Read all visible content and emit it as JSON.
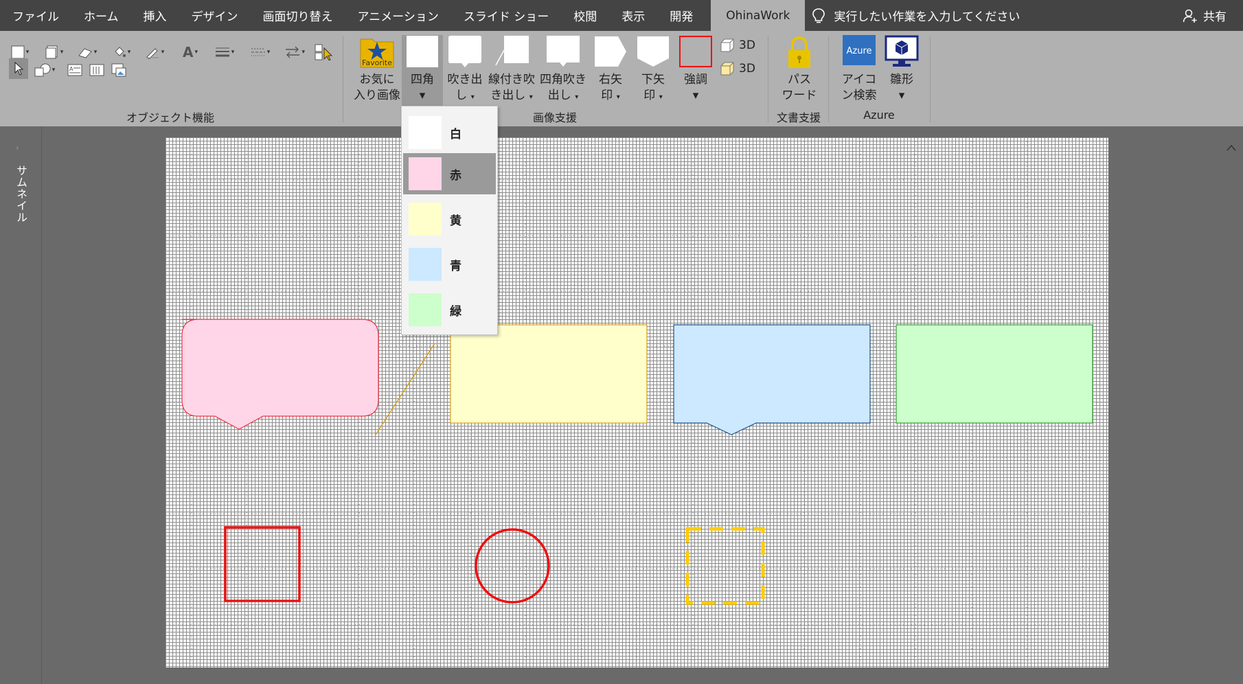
{
  "menu": {
    "tabs": [
      "ファイル",
      "ホーム",
      "挿入",
      "デザイン",
      "画面切り替え",
      "アニメーション",
      "スライド ショー",
      "校閲",
      "表示",
      "開発"
    ],
    "active_tab": "OhinaWork",
    "tell_me": "実行したい作業を入力してください",
    "share": "共有"
  },
  "ribbon": {
    "groups": {
      "object": "オブジェクト機能",
      "image": "画像支援",
      "document": "文書支援",
      "azure": "Azure"
    },
    "favorite_icon_text": "Favorite",
    "buttons": {
      "favorite": [
        "お気に",
        "入り画像"
      ],
      "square": [
        "四角",
        ""
      ],
      "callout": [
        "吹き出",
        "し"
      ],
      "line_callout": [
        "線付き吹",
        "き出し"
      ],
      "square_callout": [
        "四角吹き",
        "出し"
      ],
      "right_arrow": [
        "右矢",
        "印"
      ],
      "down_arrow": [
        "下矢",
        "印"
      ],
      "emphasis": [
        "強調",
        ""
      ],
      "password": [
        "パス",
        "ワード"
      ],
      "icon_search": [
        "アイコ",
        "ン検索"
      ],
      "template": [
        "雛形",
        ""
      ]
    },
    "azure_icon_text": "Azure",
    "three_d_1": "3D",
    "three_d_2": "3D"
  },
  "dropdown": {
    "items": [
      {
        "label": "白",
        "color": "#ffffff"
      },
      {
        "label": "赤",
        "color": "#ffd5e8"
      },
      {
        "label": "黄",
        "color": "#ffffcc"
      },
      {
        "label": "青",
        "color": "#cce9ff"
      },
      {
        "label": "緑",
        "color": "#ccffcc"
      }
    ],
    "hover_index": 1
  },
  "thumbnail": {
    "label": "サムネイル"
  },
  "colors": {
    "menubar": "#444444",
    "ribbon": "#b1b1b1",
    "pink": "#ffd5e8",
    "yellow": "#ffffcc",
    "blue": "#cce9ff",
    "green": "#ccffcc",
    "red": "#ee1111",
    "gold": "#ffcc00"
  }
}
